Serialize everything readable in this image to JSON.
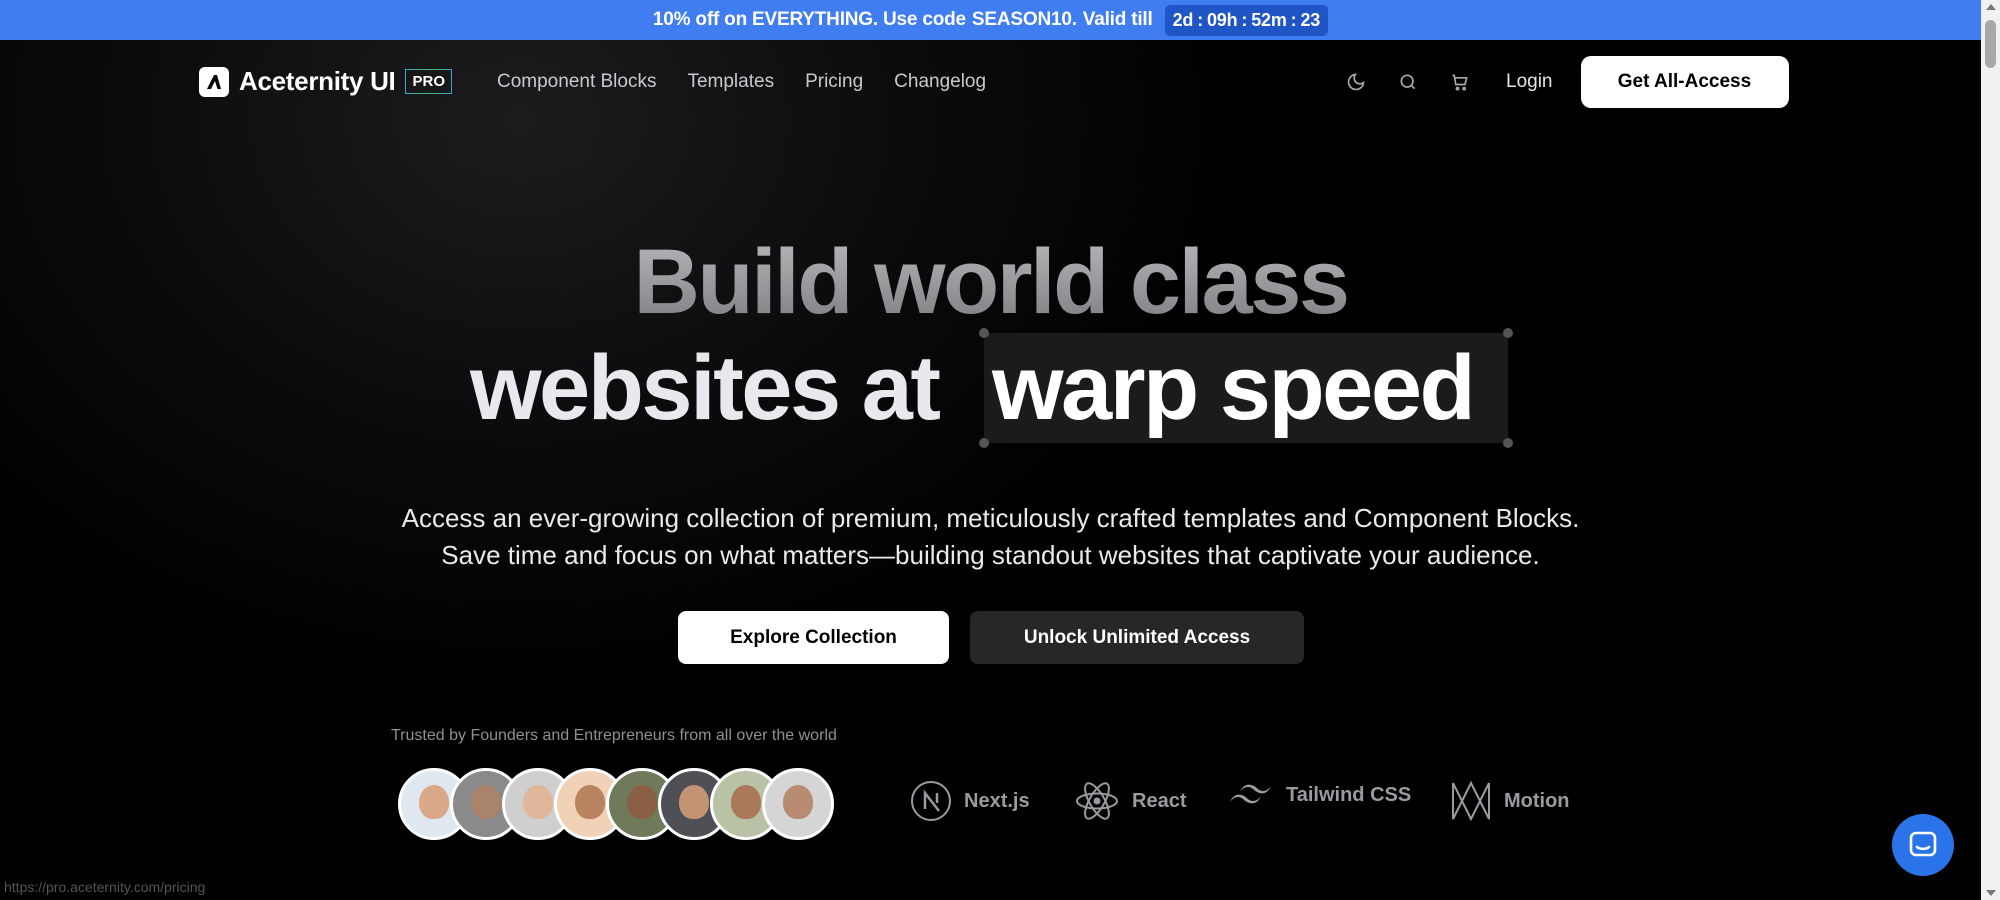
{
  "promo": {
    "text": "10% off on EVERYTHING. Use code",
    "code": "SEASON10.",
    "valid": "Valid till",
    "timer": {
      "d": "2",
      "d_unit": "d",
      "h": "09",
      "h_unit": "h",
      "m": "52",
      "m_unit": "m",
      "s": "23",
      "sep": ":"
    }
  },
  "nav": {
    "brand": "Aceternity UI",
    "badge": "PRO",
    "links": [
      "Component Blocks",
      "Templates",
      "Pricing",
      "Changelog"
    ],
    "login": "Login",
    "cta": "Get All-Access",
    "icons": [
      "moon-icon",
      "search-icon",
      "cart-icon"
    ]
  },
  "hero": {
    "line1": "Build world class",
    "line2_prefix": "websites at",
    "line2_highlight": "warp speed",
    "subtitle_l1": "Access an ever-growing collection of premium, meticulously crafted templates and Component Blocks.",
    "subtitle_l2": "Save time and focus on what matters—building standout websites that captivate your audience.",
    "btn_primary": "Explore Collection",
    "btn_secondary": "Unlock Unlimited Access"
  },
  "trust": {
    "label": "Trusted by Founders and Entrepreneurs from all over the world",
    "avatars": 8,
    "tech": [
      "Next.js",
      "React",
      "Tailwind CSS",
      "Motion"
    ]
  },
  "status_url": "https://pro.aceternity.com/pricing",
  "colors": {
    "promo_bg": "#3f7df0",
    "chat_bg": "#2a73e8",
    "page_bg": "#000000"
  }
}
